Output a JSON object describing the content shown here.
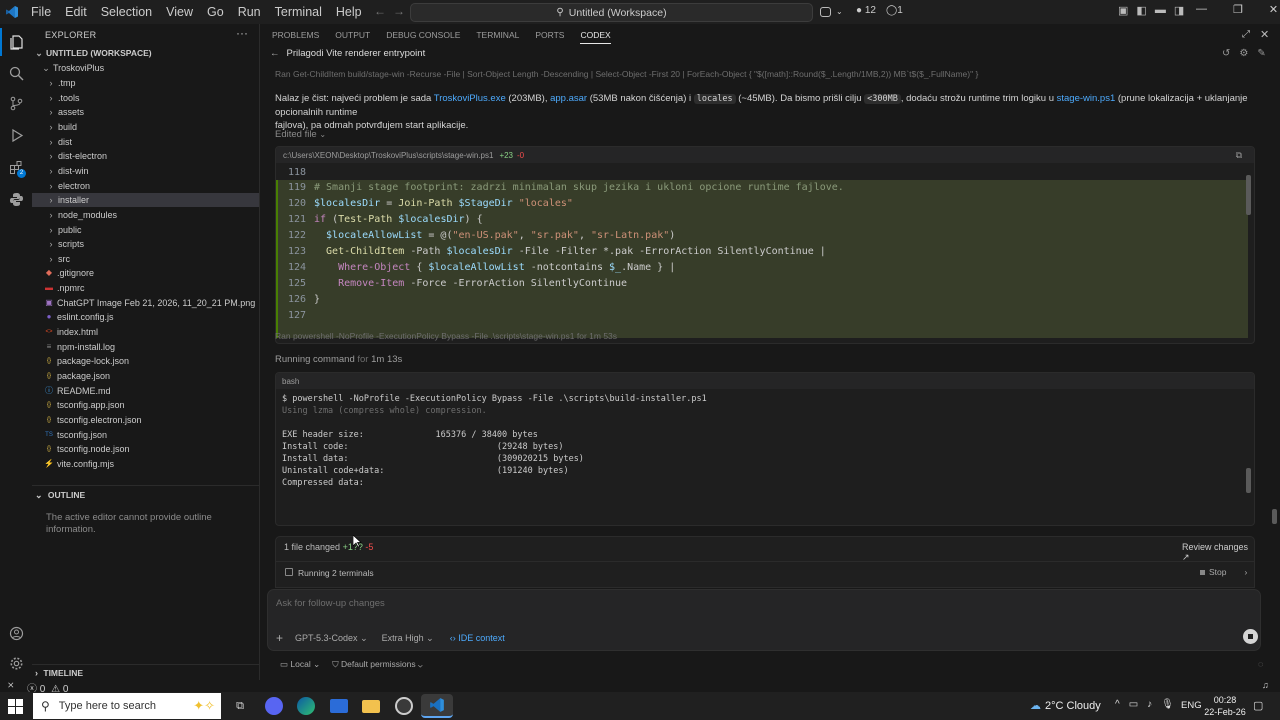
{
  "titlebar": {
    "menu": [
      "File",
      "Edit",
      "Selection",
      "View",
      "Go",
      "Run",
      "Terminal",
      "Help"
    ],
    "search_text": "Untitled (Workspace)",
    "notif_count": "12",
    "ports_count": "1"
  },
  "sidebar": {
    "explorer_title": "EXPLORER",
    "workspace_title": "UNTITLED (WORKSPACE)",
    "root_folder": "TroskoviPlus",
    "folders": [
      ".tmp",
      ".tools",
      "assets",
      "build",
      "dist",
      "dist-electron",
      "dist-win",
      "electron",
      "installer",
      "node_modules",
      "public",
      "scripts",
      "src"
    ],
    "files": [
      {
        "name": ".gitignore",
        "icon": "git-icon"
      },
      {
        "name": ".npmrc",
        "icon": "npm-icon"
      },
      {
        "name": "ChatGPT Image Feb 21, 2026, 11_20_21 PM.png",
        "icon": "image-icon"
      },
      {
        "name": "eslint.config.js",
        "icon": "eslint-icon"
      },
      {
        "name": "index.html",
        "icon": "html-icon"
      },
      {
        "name": "npm-install.log",
        "icon": "log-icon"
      },
      {
        "name": "package-lock.json",
        "icon": "json-icon"
      },
      {
        "name": "package.json",
        "icon": "json-icon"
      },
      {
        "name": "README.md",
        "icon": "info-icon"
      },
      {
        "name": "tsconfig.app.json",
        "icon": "json-icon"
      },
      {
        "name": "tsconfig.electron.json",
        "icon": "json-icon"
      },
      {
        "name": "tsconfig.json",
        "icon": "ts-icon"
      },
      {
        "name": "tsconfig.node.json",
        "icon": "json-icon"
      },
      {
        "name": "vite.config.mjs",
        "icon": "vite-icon"
      }
    ],
    "outline_title": "OUTLINE",
    "outline_message": "The active editor cannot provide outline information.",
    "timeline_title": "TIMELINE"
  },
  "panel": {
    "tabs": [
      "PROBLEMS",
      "OUTPUT",
      "DEBUG CONSOLE",
      "TERMINAL",
      "PORTS",
      "CODEX"
    ],
    "active_tab": "CODEX",
    "thread_title": "Prilagodi Vite renderer entrypoint",
    "ran_cmd_top": "Ran Get-ChildItem build/stage-win -Recurse -File | Sort-Object Length -Descending | Select-Object -First 20 | ForEach-Object { \"$([math]::Round($_.Length/1MB,2)) MB`t$($_.FullName)\" }",
    "message": {
      "p1": "Nalaz je čist: najveći problem je sada ",
      "l1": "TroskoviPlus.exe",
      "p2": " (203MB), ",
      "l2": "app.asar",
      "p3": " (53MB nakon čišćenja) i ",
      "c1": "locales",
      "p4": " (~45MB). Da bismo prišli cilju ",
      "c2": "<300MB",
      "p5": ", dodaću strožu runtime trim logiku u ",
      "l3": "stage-win.ps1",
      "p6": " (prune lokalizacija + uklanjanje opcionalnih runtime",
      "line2": "fajlova), pa odmah potvrđujem start aplikacije."
    },
    "edited_file_label": "Edited file",
    "diff_path": "c:\\Users\\XEON\\Desktop\\TroskoviPlus\\scripts\\stage-win.ps1",
    "diff_added": "+23",
    "diff_removed": "-0",
    "ran_cmd2": "Ran powershell -NoProfile -ExecutionPolicy Bypass -File .\\scripts\\stage-win.ps1 for 1m 53s",
    "running_label": "Running command",
    "running_for": " for ",
    "running_time": "1m 13s",
    "terminal_lang": "bash",
    "terminal_lines": [
      "$ powershell -NoProfile -ExecutionPolicy Bypass -File .\\scripts\\build-installer.ps1",
      "Using lzma (compress whole) compression.",
      "",
      "EXE header size:              165376 / 38400 bytes",
      "Install code:                             (29248 bytes)",
      "Install data:                             (309020215 bytes)",
      "Uninstall code+data:                      (191240 bytes)",
      "Compressed data:"
    ],
    "files_changed": "1 file changed",
    "fc_added": "+1??",
    "fc_removed": "-5",
    "review_changes": "Review changes",
    "running_terminals": "Running 2 terminals",
    "stop_label": "Stop",
    "input_placeholder": "Ask for follow-up changes",
    "model": "GPT-5.3-Codex",
    "effort": "Extra High",
    "ide_context": "IDE context",
    "local_label": "Local",
    "permissions_label": "Default permissions"
  },
  "statusbar": {
    "errors": "0",
    "warnings": "0"
  },
  "taskbar": {
    "search_placeholder": "Type here to search",
    "weather": "2°C  Cloudy",
    "lang": "ENG",
    "time": "00:28",
    "date": "22-Feb-26"
  }
}
